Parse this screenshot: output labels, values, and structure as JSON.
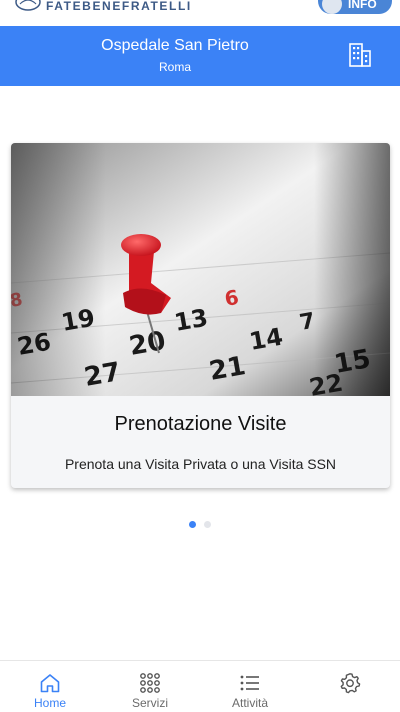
{
  "topbar": {
    "brand": "FATEBENEFRATELLI",
    "info_label": "INFO"
  },
  "header": {
    "title": "Ospedale San Pietro",
    "subtitle": "Roma"
  },
  "carousel": {
    "card": {
      "title": "Prenotazione Visite",
      "description": "Prenota una Visita Privata o una Visita SSN"
    },
    "calendar_numbers": [
      "19",
      "13",
      "7",
      "26",
      "20",
      "14",
      "27",
      "21",
      "15",
      "6",
      "8",
      "22"
    ],
    "active_index": 0,
    "total": 2
  },
  "tabbar": {
    "tabs": [
      {
        "label": "Home",
        "icon": "home-icon",
        "active": true
      },
      {
        "label": "Servizi",
        "icon": "grid-icon",
        "active": false
      },
      {
        "label": "Attività",
        "icon": "list-icon",
        "active": false
      },
      {
        "label": "",
        "icon": "settings-icon",
        "active": false
      }
    ]
  },
  "colors": {
    "primary": "#3b82f6",
    "brand_text": "#3d5a86",
    "card_bg": "#f5f6f8",
    "pin": "#e0202a"
  }
}
